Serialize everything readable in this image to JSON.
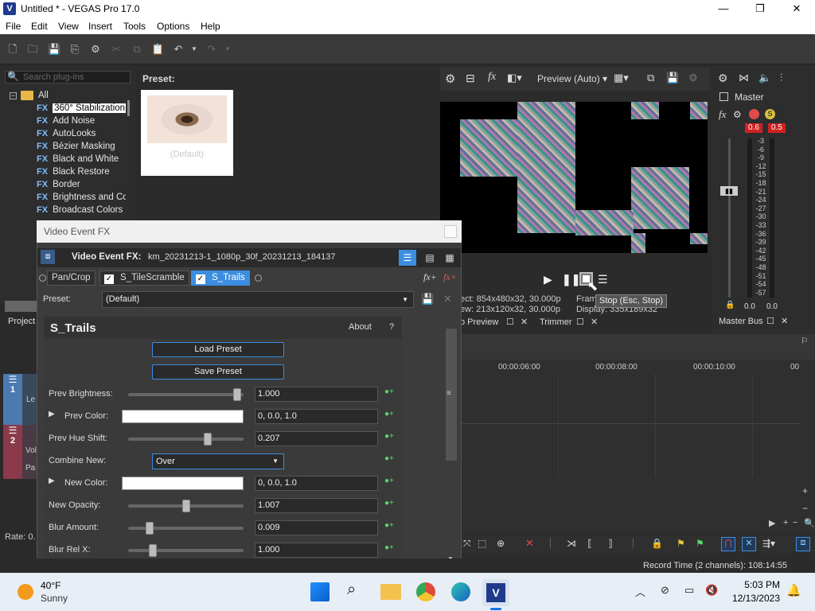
{
  "window": {
    "title": "Untitled * - VEGAS Pro 17.0",
    "app_icon": "V",
    "minimize": "—",
    "maximize": "❐",
    "close": "✕"
  },
  "menu": [
    "File",
    "Edit",
    "View",
    "Insert",
    "Tools",
    "Options",
    "Help"
  ],
  "plugins": {
    "search_placeholder": "Search plug-ins",
    "root": "All",
    "items": [
      "360° Stabilization",
      "Add Noise",
      "AutoLooks",
      "Bézier Masking",
      "Black and White",
      "Black Restore",
      "Border",
      "Brightness and Co",
      "Broadcast Colors"
    ],
    "fx_prefix": "FX"
  },
  "preset_panel": {
    "label": "Preset:",
    "card_label": "(Default)"
  },
  "preview": {
    "quality": "Preview (Auto)",
    "project_line": "ect:  854x480x32, 30.000p",
    "preview_line": "ew:  213x120x32, 30.000p",
    "frame_label": "Fram",
    "display_line": "Display:   335x189x32",
    "tooltip": "Stop (Esc, Stop)",
    "tab_video_preview": "o Preview",
    "tab_trimmer": "Trimmer"
  },
  "master": {
    "label": "Master",
    "peak_left": "0.6",
    "peak_right": "0.5",
    "scale": [
      "3",
      "6",
      "9",
      "12",
      "15",
      "18",
      "21",
      "24",
      "27",
      "30",
      "33",
      "36",
      "39",
      "42",
      "45",
      "48",
      "51",
      "54",
      "57"
    ],
    "bottom_left": "0.0",
    "bottom_right": "0.0",
    "tab": "Master Bus"
  },
  "dialog": {
    "title": "Video Event FX",
    "header_label": "Video Event FX:",
    "header_file": "km_20231213-1_1080p_30f_20231213_184137",
    "chain": [
      "Pan/Crop",
      "S_TileScramble",
      "S_Trails"
    ],
    "preset_label": "Preset:",
    "preset_value": "(Default)",
    "plugin_name": "S_Trails",
    "about": "About",
    "help": "?",
    "load_preset": "Load Preset",
    "save_preset": "Save Preset",
    "params": {
      "prev_brightness": {
        "label": "Prev Brightness:",
        "value": "1.000",
        "level": 0.98
      },
      "prev_color": {
        "label": "Prev Color:",
        "value": "0, 0.0, 1.0"
      },
      "prev_hue_shift": {
        "label": "Prev Hue Shift:",
        "value": "0.207",
        "level": 0.7
      },
      "combine_new": {
        "label": "Combine New:",
        "value": "Over"
      },
      "new_color": {
        "label": "New Color:",
        "value": "0, 0.0, 1.0"
      },
      "new_opacity": {
        "label": "New Opacity:",
        "value": "1.007",
        "level": 0.5
      },
      "blur_amount": {
        "label": "Blur Amount:",
        "value": "0.009",
        "level": 0.16
      },
      "blur_rel_x": {
        "label": "Blur Rel X:",
        "value": "1.000",
        "level": 0.19
      }
    }
  },
  "left_panel": {
    "project_tab": "Project",
    "rate": "Rate: 0.",
    "track1": "1",
    "track2": "2",
    "track1_label": "Le",
    "track2_label1": "Vol",
    "track2_label2": "Pa"
  },
  "timeline": {
    "marks": [
      "00:00:06:00",
      "00:00:08:00",
      "00:00:10:00",
      "00"
    ]
  },
  "status": {
    "record_time": "Record Time (2 channels): 108:14:55"
  },
  "taskbar": {
    "weather_temp": "40°F",
    "weather_desc": "Sunny",
    "time": "5:03 PM",
    "date": "12/13/2023"
  }
}
